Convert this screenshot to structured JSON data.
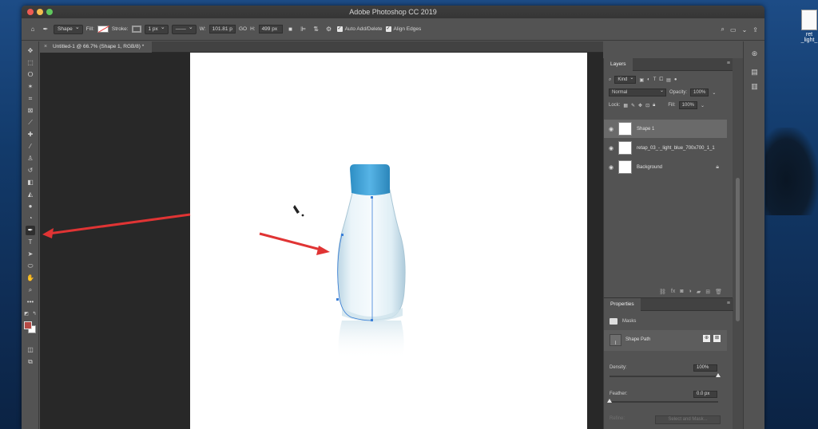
{
  "app": {
    "title": "Adobe Photoshop CC 2019",
    "document_tab": "Untitled-1 @ 66.7% (Shape 1, RGB/8) *"
  },
  "options_bar": {
    "mode": "Shape",
    "fill_label": "Fill:",
    "stroke_label": "Stroke:",
    "stroke_width": "1 px",
    "w_label": "W:",
    "w_value": "101.81 p",
    "link_label": "GO",
    "h_label": "H:",
    "h_value": "499 px",
    "auto_add_delete": "Auto Add/Delete",
    "align_edges": "Align Edges"
  },
  "layers_panel": {
    "tab": "Layers",
    "filter_kind": "Kind",
    "blend_mode": "Normal",
    "opacity_label": "Opacity:",
    "opacity_value": "100%",
    "lock_label": "Lock:",
    "fill_label": "Fill:",
    "fill_value": "100%",
    "layers": [
      {
        "name": "Shape 1",
        "selected": true
      },
      {
        "name": "retap_03_-_light_blue_700x700_1_1",
        "selected": false
      },
      {
        "name": "Background",
        "selected": false
      }
    ]
  },
  "properties_panel": {
    "tab": "Properties",
    "masks_label": "Masks",
    "shape_path_label": "Shape Path",
    "density_label": "Density:",
    "density_value": "100%",
    "density_level": 1.0,
    "feather_label": "Feather:",
    "feather_value": "0.0 px",
    "feather_level": 0.0,
    "refine_label": "Refine:",
    "select_mask_button": "Select and Mask..."
  },
  "desktop": {
    "file_label_1": "ret",
    "file_label_2": "_light_"
  },
  "colors": {
    "foreground": "#b54a45",
    "background": "#ffffff",
    "annotation_arrow": "#e03434",
    "bottle_cap": "#3ea0d6",
    "path_line": "#3a7fd8"
  }
}
